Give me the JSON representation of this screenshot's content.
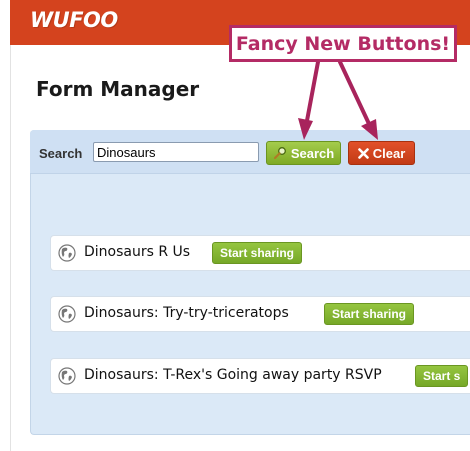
{
  "header": {
    "logo_text": "WUFOO",
    "brand_color": "#d4431e"
  },
  "page": {
    "title": "Form Manager"
  },
  "search": {
    "label": "Search",
    "value": "Dinosaurs",
    "search_button": "Search",
    "clear_button": "Clear"
  },
  "annotation": {
    "text": "Fancy New Buttons!",
    "color": "#b42b65"
  },
  "forms": [
    {
      "title": "Dinosaurs R Us",
      "share_label": "Start sharing"
    },
    {
      "title": "Dinosaurs: Try-try-triceratops",
      "share_label": "Start sharing"
    },
    {
      "title": "Dinosaurs: T-Rex's Going away party RSVP",
      "share_label": "Start s"
    }
  ]
}
